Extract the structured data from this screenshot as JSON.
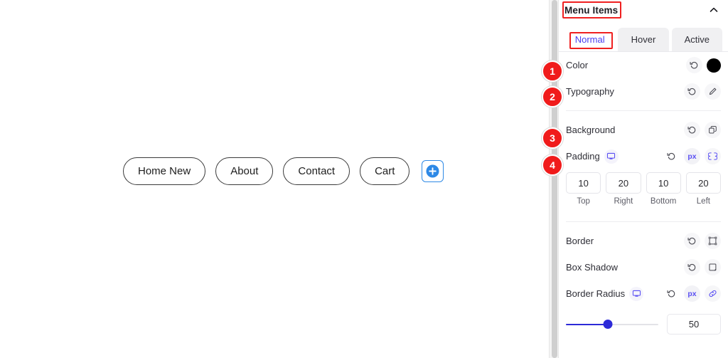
{
  "canvas": {
    "menu_items": [
      {
        "label": "Home New"
      },
      {
        "label": "About"
      },
      {
        "label": "Contact"
      },
      {
        "label": "Cart"
      }
    ],
    "add_button": {
      "icon": "plus-circle-icon",
      "color": "#2e89e6"
    }
  },
  "panel": {
    "title": "Menu Items",
    "collapse_icon": "chevron-up-icon",
    "tabs": [
      {
        "label": "Normal",
        "active": true
      },
      {
        "label": "Hover",
        "active": false
      },
      {
        "label": "Active",
        "active": false
      }
    ],
    "active_tab_color": "#4a3df0",
    "controls": {
      "color": {
        "label": "Color",
        "reset_icon": "reset-icon",
        "swatch_icon": "color-swatch",
        "swatch_color": "#000000"
      },
      "typography": {
        "label": "Typography",
        "reset_icon": "reset-icon",
        "edit_icon": "pencil-icon"
      },
      "background": {
        "label": "Background",
        "reset_icon": "reset-icon",
        "layers_icon": "copy-layers-icon"
      },
      "padding": {
        "label": "Padding",
        "device_icon": "desktop-icon",
        "reset_icon": "reset-icon",
        "unit": "px",
        "link_icon": "link-sides-icon",
        "values": [
          {
            "value": "10",
            "name": "Top"
          },
          {
            "value": "20",
            "name": "Right"
          },
          {
            "value": "10",
            "name": "Bottom"
          },
          {
            "value": "20",
            "name": "Left"
          }
        ]
      },
      "border": {
        "label": "Border",
        "reset_icon": "reset-icon",
        "type_icon": "border-box-icon"
      },
      "box_shadow": {
        "label": "Box Shadow",
        "reset_icon": "reset-icon",
        "type_icon": "shadow-box-icon"
      },
      "border_radius": {
        "label": "Border Radius",
        "device_icon": "desktop-icon",
        "reset_icon": "reset-icon",
        "unit": "px",
        "link_icon": "link-corners-icon",
        "slider_value": "50",
        "slider_percent": 45,
        "slider_color": "#2d2ad8"
      }
    }
  },
  "annotations": {
    "badges": [
      {
        "number": "1",
        "target": "color"
      },
      {
        "number": "2",
        "target": "typography"
      },
      {
        "number": "3",
        "target": "background"
      },
      {
        "number": "4",
        "target": "padding"
      }
    ],
    "boxes": [
      {
        "target": "panel-title"
      },
      {
        "target": "tab-normal"
      }
    ],
    "color": "#ef2020"
  }
}
